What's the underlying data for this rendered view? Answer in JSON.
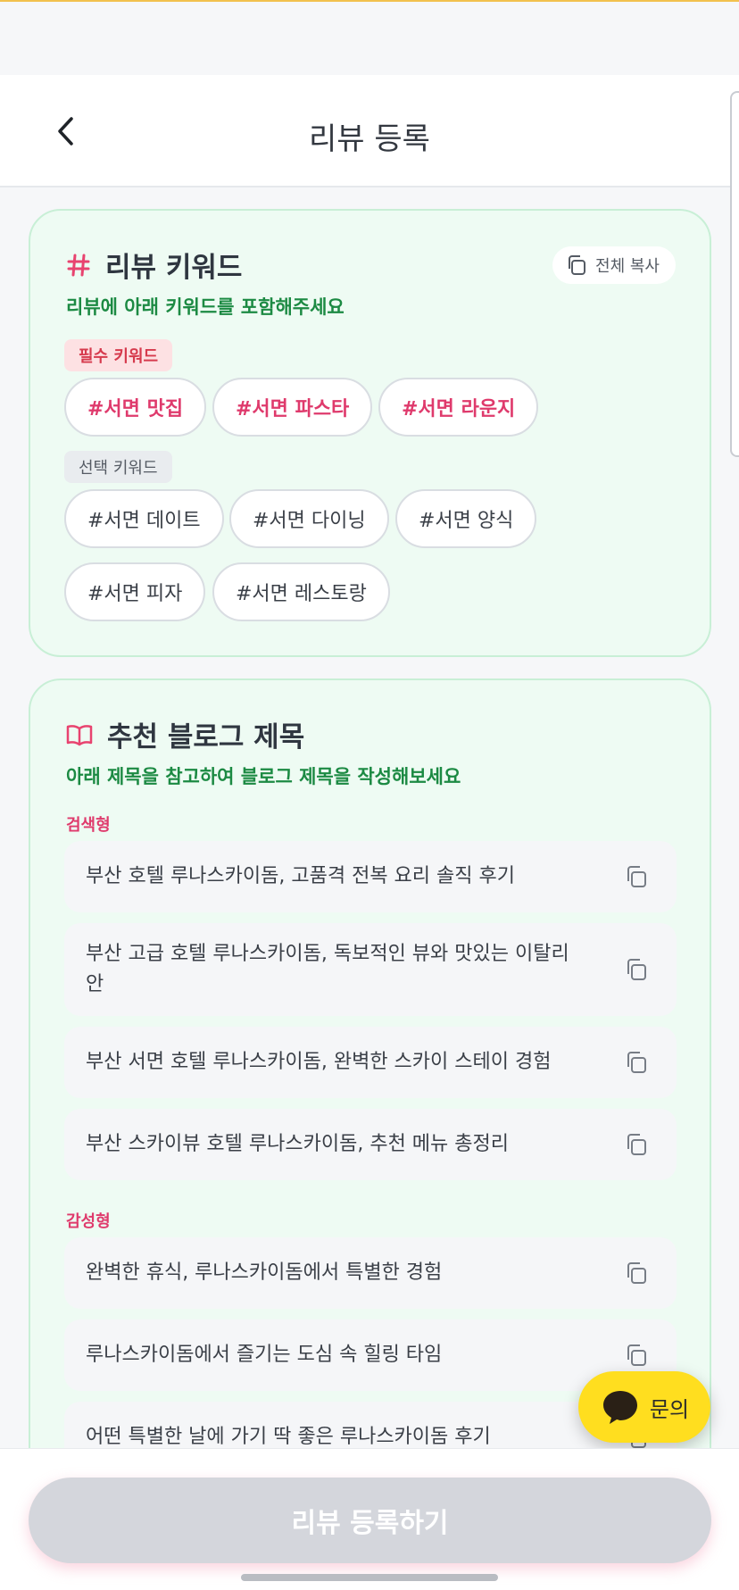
{
  "header": {
    "title": "리뷰 등록"
  },
  "keywords": {
    "title": "리뷰 키워드",
    "subtitle": "리뷰에 아래 키워드를 포함해주세요",
    "copy_all_label": "전체 복사",
    "required_label": "필수 키워드",
    "optional_label": "선택 키워드",
    "required": [
      "#서면 맛집",
      "#서면 파스타",
      "#서면 라운지"
    ],
    "optional": [
      "#서면 데이트",
      "#서면 다이닝",
      "#서면 양식",
      "#서면 피자",
      "#서면 레스토랑"
    ]
  },
  "titles": {
    "title": "추천 블로그 제목",
    "subtitle": "아래 제목을 참고하여 블로그 제목을 작성해보세요",
    "search_label": "검색형",
    "search": [
      "부산 호텔 루나스카이돔, 고품격 전복 요리 솔직 후기",
      "부산 고급 호텔 루나스카이돔, 독보적인 뷰와 맛있는 이탈리안",
      "부산 서면 호텔 루나스카이돔, 완벽한 스카이 스테이 경험",
      "부산 스카이뷰 호텔 루나스카이돔, 추천 메뉴 총정리"
    ],
    "emotional_label": "감성형",
    "emotional": [
      "완벽한 휴식, 루나스카이돔에서 특별한 경험",
      "루나스카이돔에서 즐기는 도심 속 힐링 타임",
      "어떤 특별한 날에 가기 딱 좋은 루나스카이돔 후기"
    ]
  },
  "inquiry": {
    "label": "문의"
  },
  "submit": {
    "label": "리뷰 등록하기"
  },
  "colors": {
    "accent_pink": "#df3a6c",
    "accent_green": "#1c8a43",
    "card_bg": "#eefbf3",
    "inquiry_yellow": "#ffde1f",
    "submit_disabled": "#d4d6dc"
  },
  "icons": {
    "back": "chevron-left-icon",
    "hash": "hash-icon",
    "book": "book-open-icon",
    "copy": "copy-icon",
    "chat": "chat-bubble-icon"
  }
}
